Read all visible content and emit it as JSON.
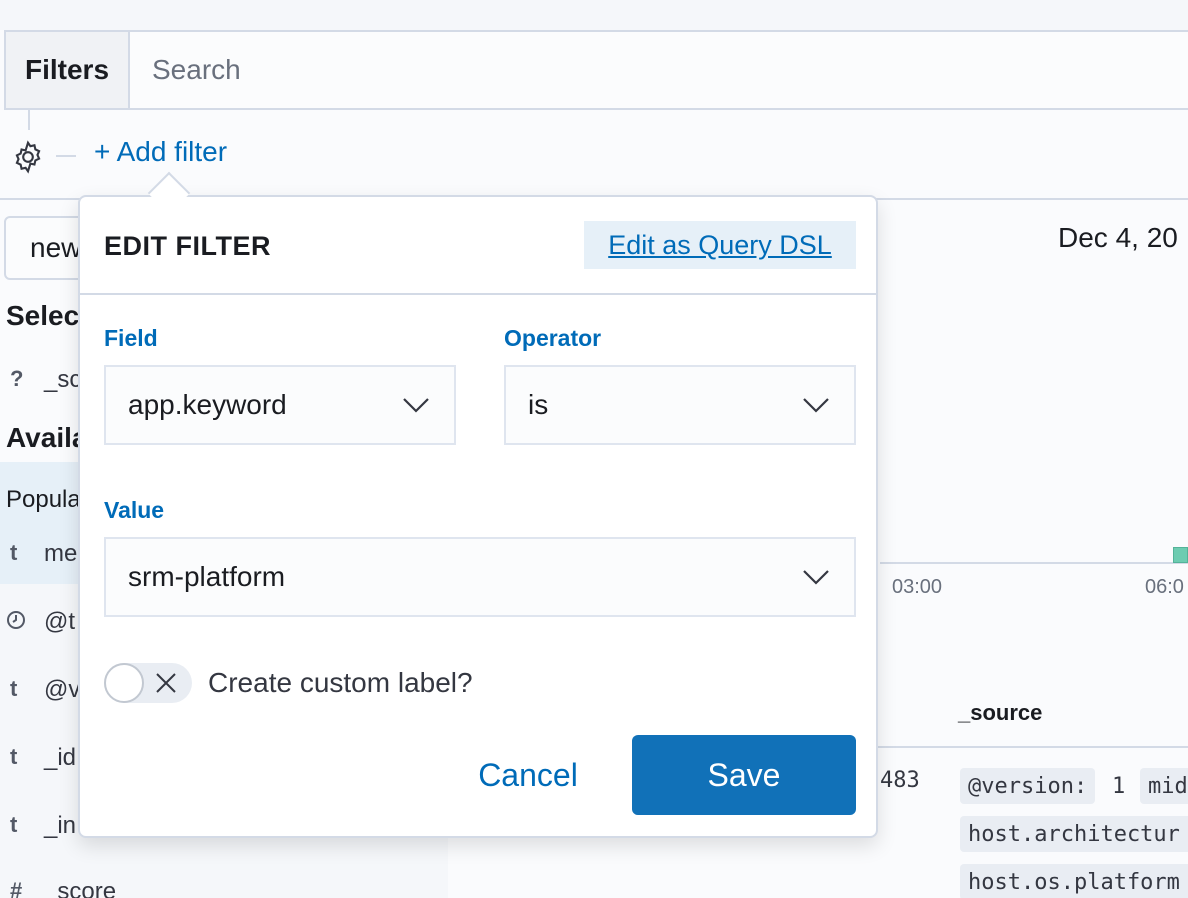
{
  "query_bar": {
    "filters_label": "Filters",
    "search_placeholder": "Search"
  },
  "filter_bar": {
    "settings_icon": "gear-icon",
    "add_filter_label": "+ Add filter"
  },
  "sidebar": {
    "index_pattern_value": "new",
    "selected_title": "Selec",
    "selected_fields": [
      {
        "type": "?",
        "name": "_sc"
      }
    ],
    "available_title": "Availa",
    "popular_label": "Popula",
    "popular_fields": [
      {
        "type": "t",
        "name": "me"
      }
    ],
    "fields": [
      {
        "type": "clock-icon",
        "name": "@t"
      },
      {
        "type": "t",
        "name": "@v"
      },
      {
        "type": "t",
        "name": "_id"
      },
      {
        "type": "t",
        "name": "_in"
      },
      {
        "type": "#",
        "name": "_score"
      }
    ]
  },
  "histogram": {
    "date_label": "Dec 4, 20",
    "ticks": [
      "03:00",
      "06:0"
    ]
  },
  "doc_table": {
    "source_header": "_source",
    "row_number": "483",
    "source_entries": [
      {
        "key": "@version:",
        "value": "1"
      },
      {
        "key": "mid",
        "value": ""
      },
      {
        "key": "host.architectur",
        "value": ""
      },
      {
        "key": "host.os.platform",
        "value": ""
      }
    ]
  },
  "edit_filter": {
    "title": "EDIT FILTER",
    "edit_dsl_label": "Edit as Query DSL",
    "field_label": "Field",
    "field_value": "app.keyword",
    "operator_label": "Operator",
    "operator_value": "is",
    "value_label": "Value",
    "value_value": "srm-platform",
    "custom_label_toggle": "Create custom label?",
    "custom_label_enabled": false,
    "cancel_label": "Cancel",
    "save_label": "Save"
  },
  "colors": {
    "accent": "#006bb8",
    "primary_button": "#1171b8",
    "border": "#d3dae6"
  }
}
